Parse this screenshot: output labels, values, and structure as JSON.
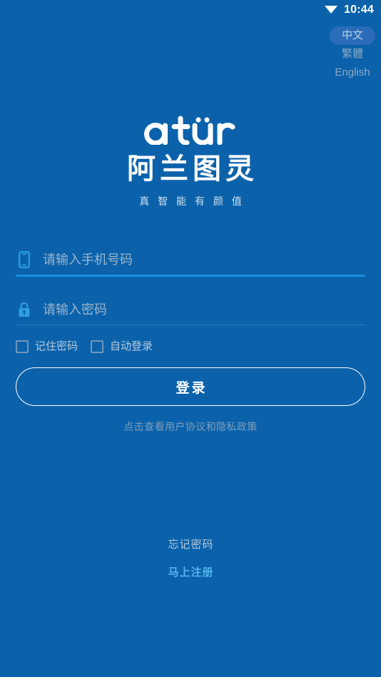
{
  "theme": {
    "background": "#0b62ab",
    "accent_underline": "#1b8fe0",
    "register_link_color": "#53b4f0",
    "active_lang_pill": "#2a6cb8"
  },
  "status_bar": {
    "time": "10:44",
    "wifi_icon": "wifi-icon"
  },
  "language_switcher": {
    "options": [
      {
        "label": "中文",
        "active": true
      },
      {
        "label": "繁體",
        "active": false
      },
      {
        "label": "English",
        "active": false
      }
    ]
  },
  "logo": {
    "wordmark": "atür",
    "brand_name_cn": "阿兰图灵",
    "tagline": "真 智 能  有 颜 值"
  },
  "form": {
    "phone": {
      "icon": "phone-icon",
      "value": "",
      "placeholder": "请输入手机号码"
    },
    "password": {
      "icon": "lock-icon",
      "value": "",
      "placeholder": "请输入密码"
    },
    "checkboxes": [
      {
        "label": "记住密码",
        "checked": false
      },
      {
        "label": "自动登录",
        "checked": false
      }
    ],
    "submit_label": "登录",
    "agreement_text": "点击查看用户协议和隐私政策"
  },
  "bottom_links": {
    "forgot_password": "忘记密码",
    "register": "马上注册"
  }
}
